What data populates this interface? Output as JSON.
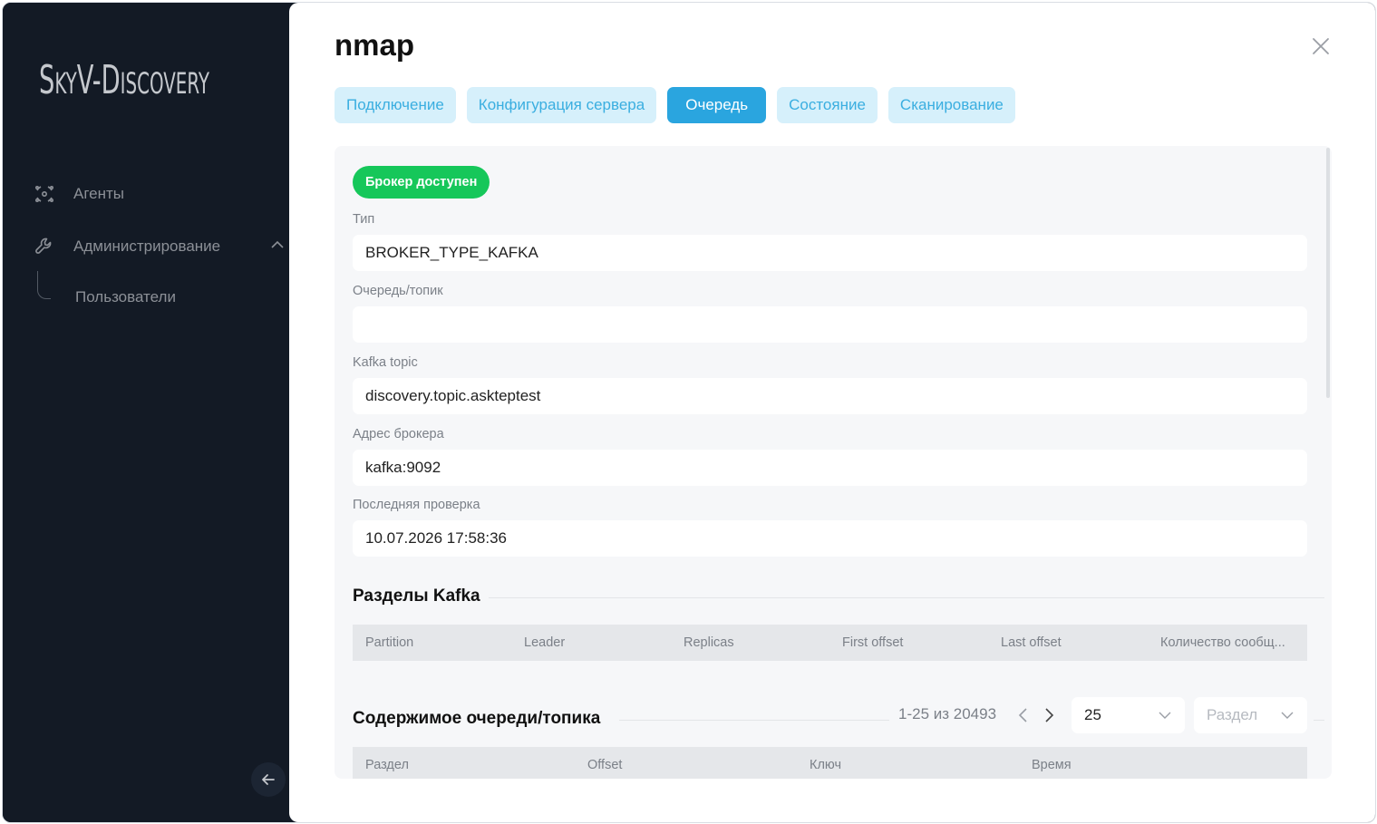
{
  "sidebar": {
    "logo": {
      "part1": "S",
      "part2": "KY",
      "part3": "V-D",
      "part4": "ISCOVERY"
    },
    "items": [
      {
        "label": "Агенты",
        "icon": "agents-icon"
      },
      {
        "label": "Администрирование",
        "icon": "wrench-icon"
      }
    ],
    "sub_items": [
      {
        "label": "Пользователи"
      }
    ]
  },
  "modal": {
    "title": "nmap",
    "tabs": [
      {
        "label": "Подключение",
        "active": false
      },
      {
        "label": "Конфигурация сервера",
        "active": false
      },
      {
        "label": "Очередь",
        "active": true
      },
      {
        "label": "Состояние",
        "active": false
      },
      {
        "label": "Сканирование",
        "active": false
      }
    ],
    "status_badge": "Брокер доступен",
    "fields": [
      {
        "label": "Тип",
        "value": "BROKER_TYPE_KAFKA"
      },
      {
        "label": "Очередь/топик",
        "value": ""
      },
      {
        "label": "Kafka topic",
        "value": "discovery.topic.askteptest"
      },
      {
        "label": "Адрес брокера",
        "value": "kafka:9092"
      },
      {
        "label": "Последняя проверка",
        "value": "10.07.2026 17:58:36"
      }
    ],
    "partitions": {
      "title": "Разделы Kafka",
      "columns": [
        "Partition",
        "Leader",
        "Replicas",
        "First offset",
        "Last offset",
        "Количество сообщ..."
      ]
    },
    "queue_content": {
      "title": "Содержимое очереди/топика",
      "pager": "1-25 из 20493",
      "page_size": "25",
      "partition_placeholder": "Раздел",
      "columns": [
        "Раздел",
        "Offset",
        "Ключ",
        "Время"
      ]
    }
  },
  "colors": {
    "sidebar_bg": "#131a25",
    "accent": "#2aa5df",
    "tab_bg": "#d6f0fb",
    "success": "#16c75a"
  }
}
